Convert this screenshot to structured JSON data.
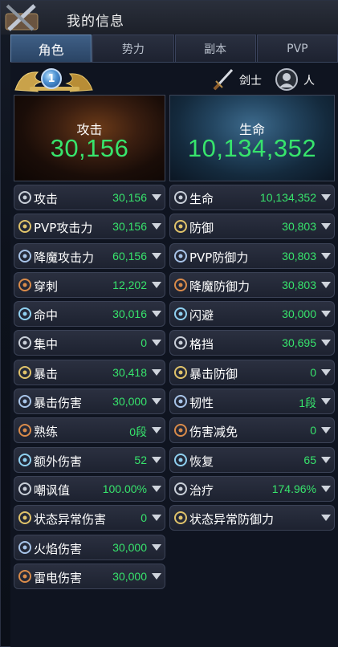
{
  "window": {
    "title": "我的信息"
  },
  "tabs": [
    {
      "label": "角色",
      "active": true
    },
    {
      "label": "势力",
      "active": false
    },
    {
      "label": "副本",
      "active": false
    },
    {
      "label": "PVP",
      "active": false
    }
  ],
  "profile": {
    "level": "1",
    "class_label": "剑士",
    "race_label": "人"
  },
  "summary": {
    "attack": {
      "label": "攻击",
      "value": "30,156"
    },
    "hp": {
      "label": "生命",
      "value": "10,134,352"
    }
  },
  "left_stats": [
    {
      "label": "攻击",
      "value": "30,156",
      "icon": "swords-icon"
    },
    {
      "label": "PVP攻击力",
      "value": "30,156",
      "icon": "pvp-attack-icon"
    },
    {
      "label": "降魔攻击力",
      "value": "60,156",
      "icon": "demon-attack-icon"
    },
    {
      "label": "穿刺",
      "value": "12,202",
      "icon": "pierce-icon"
    },
    {
      "label": "命中",
      "value": "30,016",
      "icon": "accuracy-icon"
    },
    {
      "label": "集中",
      "value": "0",
      "icon": "focus-icon"
    },
    {
      "label": "暴击",
      "value": "30,418",
      "icon": "critical-icon"
    },
    {
      "label": "暴击伤害",
      "value": "30,000",
      "icon": "critical-damage-icon"
    },
    {
      "label": "熟练",
      "value": "0段",
      "icon": "mastery-icon"
    },
    {
      "label": "额外伤害",
      "value": "52",
      "icon": "extra-damage-icon"
    },
    {
      "label": "嘲讽值",
      "value": "100.00%",
      "icon": "taunt-icon"
    },
    {
      "label": "状态异常伤害",
      "value": "0",
      "icon": "debuff-damage-icon"
    },
    {
      "label": "火焰伤害",
      "value": "30,000",
      "icon": "fire-icon"
    },
    {
      "label": "雷电伤害",
      "value": "30,000",
      "icon": "lightning-icon"
    }
  ],
  "right_stats": [
    {
      "label": "生命",
      "value": "10,134,352",
      "icon": "heart-icon"
    },
    {
      "label": "防御",
      "value": "30,803",
      "icon": "shield-icon"
    },
    {
      "label": "PVP防御力",
      "value": "30,803",
      "icon": "pvp-defense-icon"
    },
    {
      "label": "降魔防御力",
      "value": "30,803",
      "icon": "demon-defense-icon"
    },
    {
      "label": "闪避",
      "value": "30,000",
      "icon": "evasion-icon"
    },
    {
      "label": "格挡",
      "value": "30,695",
      "icon": "block-icon"
    },
    {
      "label": "暴击防御",
      "value": "0",
      "icon": "critical-defense-icon"
    },
    {
      "label": "韧性",
      "value": "1段",
      "icon": "toughness-icon"
    },
    {
      "label": "伤害减免",
      "value": "0",
      "icon": "damage-reduction-icon"
    },
    {
      "label": "恢复",
      "value": "65",
      "icon": "regen-icon"
    },
    {
      "label": "治疗",
      "value": "174.96%",
      "icon": "heal-icon"
    },
    {
      "label": "状态异常防御力",
      "value": "",
      "icon": "debuff-defense-icon"
    }
  ],
  "colors": {
    "value_green": "#37e46c",
    "tab_active": "#3f5f86",
    "row_bg": "#252a38"
  }
}
